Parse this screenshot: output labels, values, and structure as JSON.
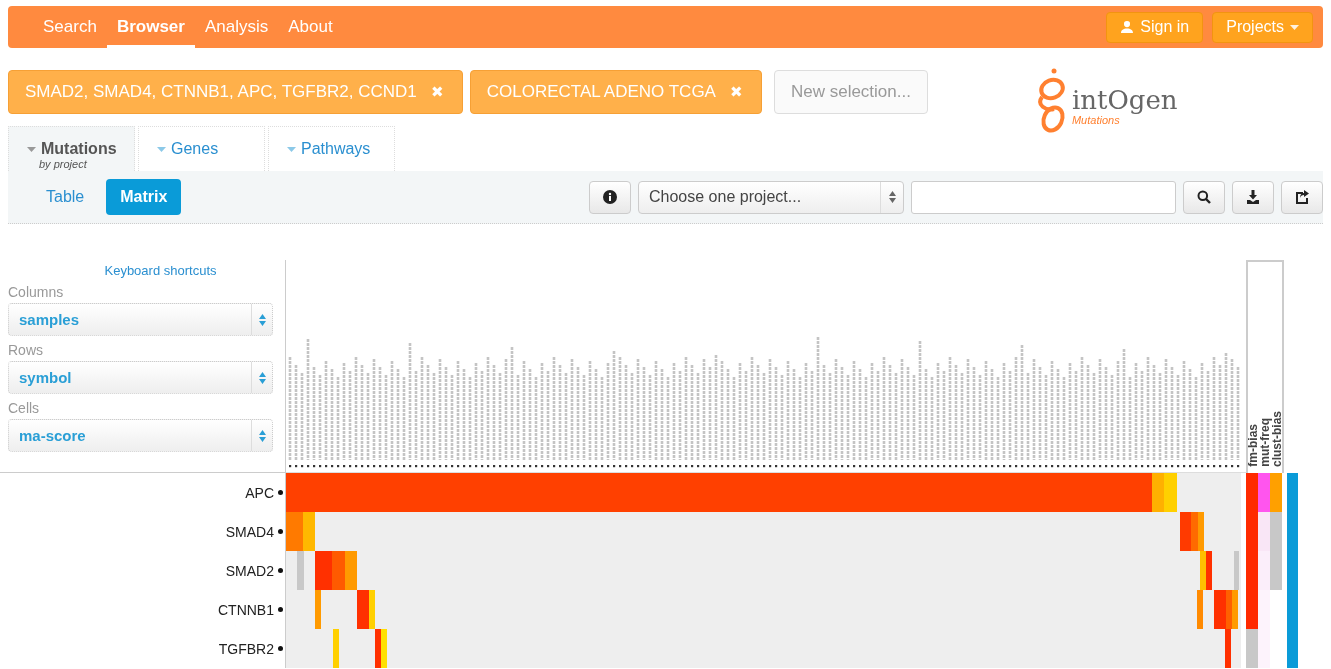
{
  "nav": {
    "items": [
      {
        "label": "Search",
        "selected": false
      },
      {
        "label": "Browser",
        "selected": true
      },
      {
        "label": "Analysis",
        "selected": false
      },
      {
        "label": "About",
        "selected": false
      }
    ],
    "sign_in": "Sign in",
    "projects": "Projects"
  },
  "selections": [
    {
      "label": "SMAD2, SMAD4, CTNNB1, APC, TGFBR2, CCND1",
      "remove": "✖"
    },
    {
      "label": "COLORECTAL ADENO TCGA",
      "remove": "✖"
    }
  ],
  "new_selection": "New selection...",
  "logo": {
    "name": "intOgen",
    "subtitle": "Mutations"
  },
  "tabs": [
    {
      "label": "Mutations",
      "sublabel": "by project",
      "selected": true
    },
    {
      "label": "Genes",
      "selected": false
    },
    {
      "label": "Pathways",
      "selected": false
    }
  ],
  "views": [
    {
      "label": "Table",
      "selected": false
    },
    {
      "label": "Matrix",
      "selected": true
    }
  ],
  "project_select": {
    "value": "Choose one project..."
  },
  "keyboard_shortcuts": "Keyboard shortcuts",
  "controls": [
    {
      "label": "Columns",
      "value": "samples"
    },
    {
      "label": "Rows",
      "value": "symbol"
    },
    {
      "label": "Cells",
      "value": "ma-score"
    }
  ],
  "annotations": [
    "fm-bias",
    "mut-freq",
    "clust-bias"
  ],
  "rows": [
    {
      "label": "APC"
    },
    {
      "label": "SMAD4"
    },
    {
      "label": "SMAD2"
    },
    {
      "label": "CTNNB1"
    },
    {
      "label": "TGFBR2"
    }
  ]
}
